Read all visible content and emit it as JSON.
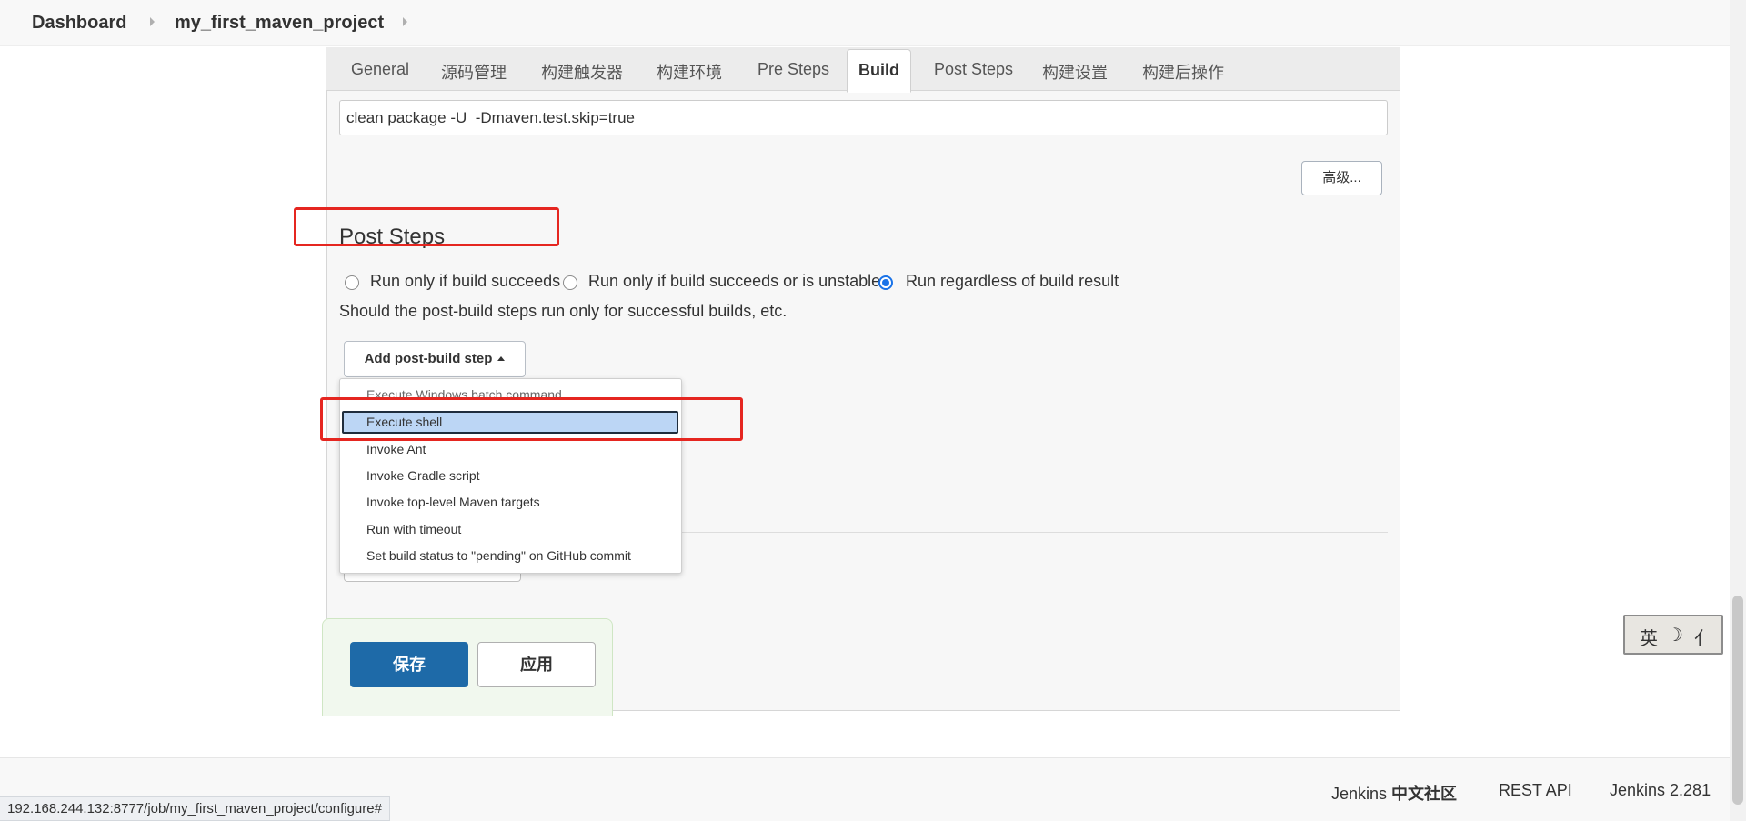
{
  "breadcrumb": {
    "items": [
      "Dashboard",
      "my_first_maven_project"
    ]
  },
  "tabs": [
    {
      "label": "General"
    },
    {
      "label": "源码管理"
    },
    {
      "label": "构建触发器"
    },
    {
      "label": "构建环境"
    },
    {
      "label": "Pre Steps"
    },
    {
      "label": "Build"
    },
    {
      "label": "Post Steps"
    },
    {
      "label": "构建设置"
    },
    {
      "label": "构建后操作"
    }
  ],
  "active_tab": "Build",
  "build": {
    "goals_value": "clean package -U  -Dmaven.test.skip=true",
    "advanced_label": "高级..."
  },
  "post_steps": {
    "title": "Post Steps",
    "options": [
      {
        "label": "Run only if build succeeds",
        "checked": false
      },
      {
        "label": "Run only if build succeeds or is unstable",
        "checked": false
      },
      {
        "label": "Run regardless of build result",
        "checked": true
      }
    ],
    "help": "Should the post-build steps run only for successful builds, etc.",
    "add_label": "Add post-build step"
  },
  "dropdown": {
    "items": [
      "Execute Windows batch command",
      "Execute shell",
      "Invoke Ant",
      "Invoke Gradle script",
      "Invoke top-level Maven targets",
      "Run with timeout",
      "Set build status to \"pending\" on GitHub commit"
    ],
    "selected": "Execute shell"
  },
  "actions": {
    "save_label": "保存",
    "apply_label": "应用"
  },
  "footer": {
    "community_prefix": "Jenkins ",
    "community_suffix": "中文社区",
    "rest_api": "REST API",
    "version": "Jenkins 2.281"
  },
  "status_url": "192.168.244.132:8777/job/my_first_maven_project/configure#",
  "ime": {
    "glyphs": [
      "英",
      "☽",
      "⺅"
    ]
  },
  "colors": {
    "annotation": "#e52620",
    "primary_button": "#1e6aa8",
    "selection": "#bcd6f5",
    "radio_checked": "#1a73e8"
  }
}
